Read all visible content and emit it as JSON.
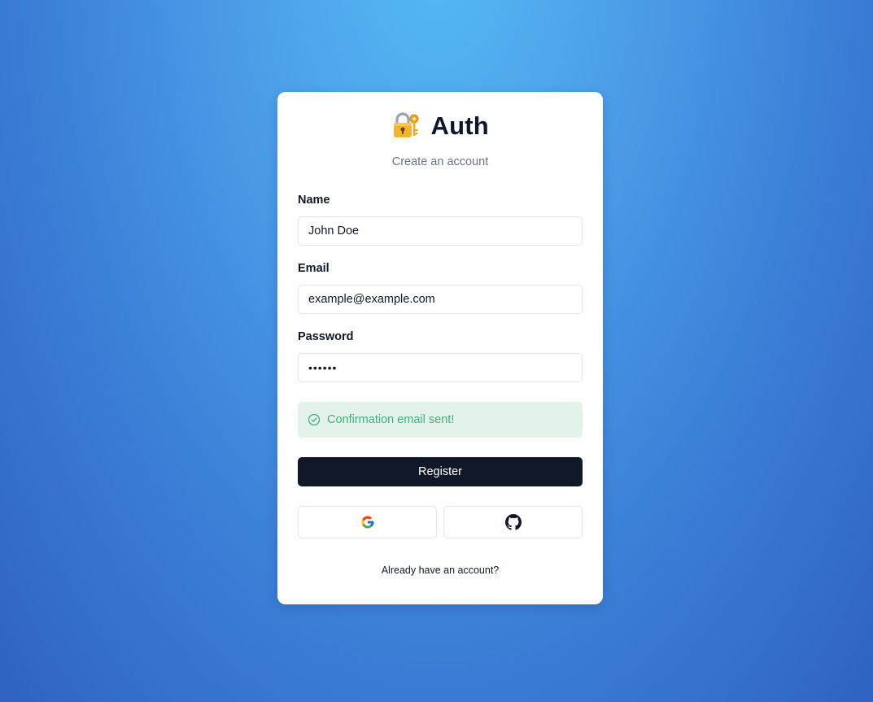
{
  "header": {
    "icon": "locked-with-key-icon",
    "title": "Auth",
    "subtitle": "Create an account"
  },
  "form": {
    "name": {
      "label": "Name",
      "value": "John Doe"
    },
    "email": {
      "label": "Email",
      "value": "example@example.com"
    },
    "password": {
      "label": "Password",
      "value": "••••••"
    }
  },
  "alert": {
    "icon": "check-circle-icon",
    "message": "Confirmation email sent!",
    "color": "#3fb27f",
    "background": "#e3f3ea"
  },
  "actions": {
    "register_label": "Register",
    "oauth": [
      {
        "provider": "google",
        "icon": "google-icon"
      },
      {
        "provider": "github",
        "icon": "github-icon"
      }
    ],
    "login_link": "Already have an account?"
  },
  "colors": {
    "primary_button": "#111827",
    "background_top": "#56bbf4",
    "background_bottom": "#2f62c3"
  }
}
